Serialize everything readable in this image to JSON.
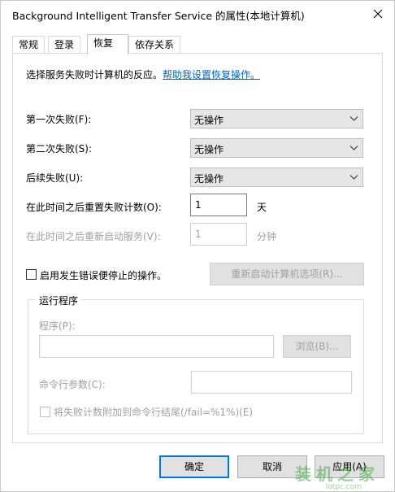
{
  "window": {
    "title": "Background Intelligent Transfer Service 的属性(本地计算机)"
  },
  "tabs": [
    {
      "label": "常规"
    },
    {
      "label": "登录"
    },
    {
      "label": "恢复"
    },
    {
      "label": "依存关系"
    }
  ],
  "active_tab": "恢复",
  "recovery": {
    "intro_text": "选择服务失败时计算机的反应。",
    "help_link": "帮助我设置恢复操作。",
    "first_failure_label": "第一次失败(F):",
    "first_failure_value": "无操作",
    "second_failure_label": "第二次失败(S):",
    "second_failure_value": "无操作",
    "subsequent_label": "后续失败(U):",
    "subsequent_value": "无操作",
    "reset_label": "在此时间之后重置失败计数(O):",
    "reset_value": "1",
    "reset_unit": "天",
    "restart_label": "在此时间之后重新启动服务(V):",
    "restart_value": "1",
    "restart_unit": "分钟",
    "enable_actions_label": "启用发生错误便停止的操作。",
    "restart_options_button": "重新启动计算机选项(R)..."
  },
  "run_program": {
    "group_title": "运行程序",
    "program_label": "程序(P):",
    "program_value": "",
    "browse_button": "浏览(B)...",
    "cmd_params_label": "命令行参数(C):",
    "cmd_params_value": "",
    "append_fail_label": "将失败计数附加到命令行结尾(/fail=%1%)(E)"
  },
  "footer": {
    "ok": "确定",
    "cancel": "取消",
    "apply": "应用(A)"
  },
  "watermark": {
    "text": "装机之家",
    "url": "lotpc.com"
  },
  "colors": {
    "accent": "#0078d7",
    "link": "#0066cc",
    "disabled": "#a0a0a0"
  }
}
